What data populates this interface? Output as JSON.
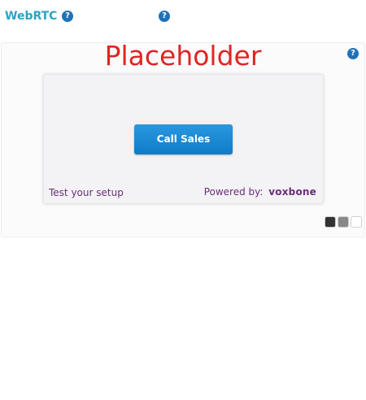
{
  "header": {
    "title": "WebRTC",
    "help_glyph": "?"
  },
  "panel": {
    "placeholder_text": "Placeholder",
    "help_glyph": "?",
    "widget": {
      "call_button_label": "Call Sales",
      "test_link_label": "Test your setup",
      "powered_by_label": "Powered by:",
      "brand_name": "voxbone"
    },
    "theme_swatches": [
      {
        "name": "dark",
        "color": "#333333"
      },
      {
        "name": "gray",
        "color": "#888888"
      },
      {
        "name": "light",
        "color": "#ffffff"
      }
    ]
  },
  "colors": {
    "accent_title": "#29a3c8",
    "help_icon": "#1f72b8",
    "placeholder_text": "#e02424",
    "button": "#1a88d4",
    "brand_purple": "#6b2e78"
  },
  "icons": {
    "help": "help-icon"
  }
}
